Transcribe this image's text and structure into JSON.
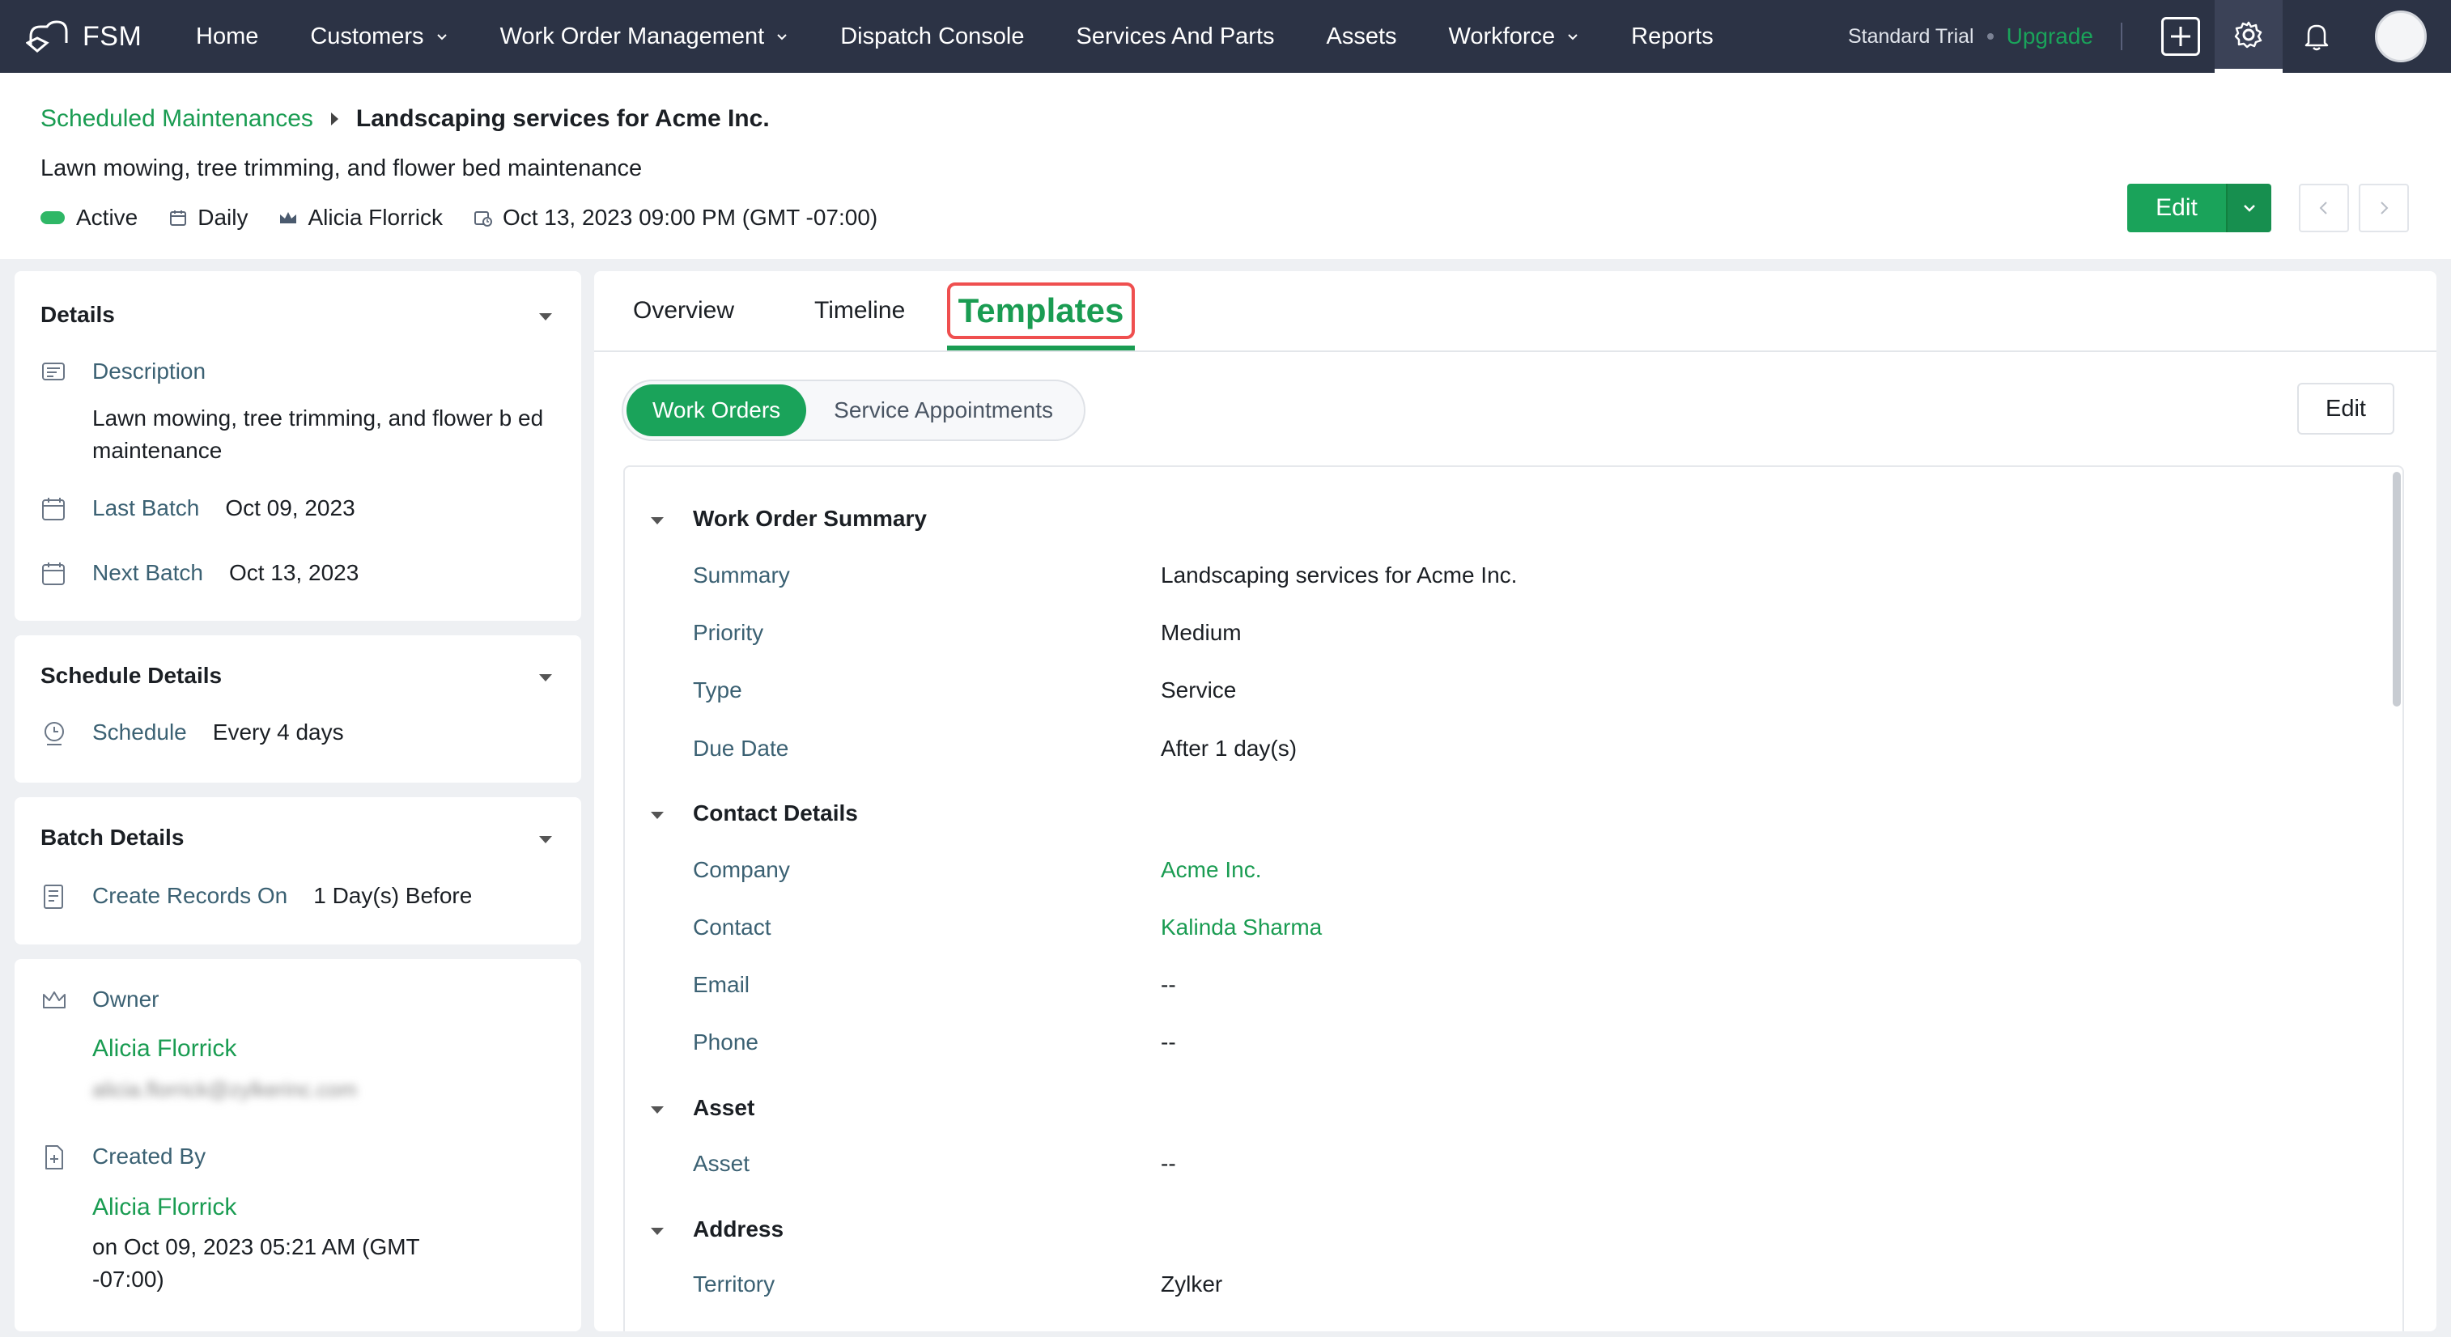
{
  "app": {
    "brand": "FSM"
  },
  "nav": {
    "items": [
      {
        "label": "Home",
        "dropdown": false
      },
      {
        "label": "Customers",
        "dropdown": true
      },
      {
        "label": "Work Order Management",
        "dropdown": true
      },
      {
        "label": "Dispatch Console",
        "dropdown": false
      },
      {
        "label": "Services And Parts",
        "dropdown": false
      },
      {
        "label": "Assets",
        "dropdown": false
      },
      {
        "label": "Workforce",
        "dropdown": true
      },
      {
        "label": "Reports",
        "dropdown": false
      }
    ],
    "trial": "Standard Trial",
    "upgrade": "Upgrade"
  },
  "header": {
    "breadcrumb_parent": "Scheduled Maintenances",
    "breadcrumb_current": "Landscaping services for Acme Inc.",
    "subtitle": "Lawn mowing, tree trimming, and flower bed maintenance",
    "status": "Active",
    "frequency": "Daily",
    "owner": "Alicia Florrick",
    "datetime": "Oct 13, 2023 09:00 PM (GMT -07:00)",
    "edit_label": "Edit"
  },
  "details": {
    "title": "Details",
    "description_label": "Description",
    "description_value": "Lawn mowing, tree trimming, and flower b ed maintenance",
    "last_batch_label": "Last Batch",
    "last_batch_value": "Oct 09, 2023",
    "next_batch_label": "Next Batch",
    "next_batch_value": "Oct 13, 2023"
  },
  "schedule": {
    "title": "Schedule Details",
    "schedule_label": "Schedule",
    "schedule_value": "Every 4 days"
  },
  "batch": {
    "title": "Batch Details",
    "create_label": "Create Records On",
    "create_value": "1 Day(s) Before"
  },
  "owner_card": {
    "owner_label": "Owner",
    "owner_name": "Alicia Florrick",
    "owner_email": "alicia.florrick@zylkerinc.com",
    "created_label": "Created By",
    "created_name": "Alicia Florrick",
    "created_on_line1": "on Oct 09, 2023 05:21 AM (GMT",
    "created_on_line2": "-07:00)"
  },
  "tabs": {
    "overview": "Overview",
    "timeline": "Timeline",
    "templates": "Templates"
  },
  "segments": {
    "active": "Work Orders",
    "other": "Service Appointments"
  },
  "panel_edit": "Edit",
  "summary": {
    "title": "Work Order Summary",
    "rows": [
      {
        "label": "Summary",
        "value": "Landscaping services for Acme Inc."
      },
      {
        "label": "Priority",
        "value": "Medium"
      },
      {
        "label": "Type",
        "value": "Service"
      },
      {
        "label": "Due Date",
        "value": "After 1 day(s)"
      }
    ]
  },
  "contact": {
    "title": "Contact Details",
    "rows": [
      {
        "label": "Company",
        "value": "Acme Inc."
      },
      {
        "label": "Contact",
        "value": "Kalinda Sharma"
      },
      {
        "label": "Email",
        "value": "--"
      },
      {
        "label": "Phone",
        "value": "--"
      }
    ]
  },
  "asset": {
    "title": "Asset",
    "rows": [
      {
        "label": "Asset",
        "value": "--"
      }
    ]
  },
  "address": {
    "title": "Address",
    "rows": [
      {
        "label": "Territory",
        "value": "Zylker"
      }
    ]
  },
  "colors": {
    "accent": "#1aa35a",
    "navbar": "#2c3345",
    "highlight": "#ef4f4f"
  }
}
